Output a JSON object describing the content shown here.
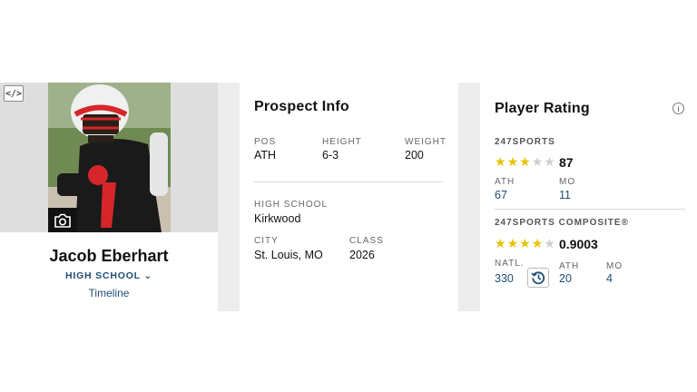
{
  "profile": {
    "name": "Jacob Eberhart",
    "school_menu": "HIGH SCHOOL",
    "timeline_link": "Timeline",
    "embed_icon": "code-icon",
    "camera_icon": "camera-icon"
  },
  "prospect": {
    "title": "Prospect Info",
    "pos_label": "POS",
    "pos_value": "ATH",
    "height_label": "HEIGHT",
    "height_value": "6-3",
    "weight_label": "WEIGHT",
    "weight_value": "200",
    "school_label": "HIGH SCHOOL",
    "school_value": "Kirkwood",
    "city_label": "CITY",
    "city_value": "St. Louis, MO",
    "class_label": "CLASS",
    "class_value": "2026"
  },
  "rating": {
    "title": "Player Rating",
    "info_icon": "info-icon",
    "s247": {
      "label": "247SPORTS",
      "stars": 3,
      "score": "87",
      "rank1_label": "ATH",
      "rank1_value": "67",
      "rank2_label": "MO",
      "rank2_value": "11"
    },
    "composite": {
      "label": "247SPORTS COMPOSITE®",
      "stars": 4,
      "score": "0.9003",
      "natl_label": "NATL.",
      "natl_value": "330",
      "history_icon": "history-icon",
      "rank1_label": "ATH",
      "rank1_value": "20",
      "rank2_label": "MO",
      "rank2_value": "4"
    }
  },
  "colors": {
    "link": "#1f4d75",
    "star_on": "#e6c200",
    "star_off": "#cfcfcf"
  }
}
